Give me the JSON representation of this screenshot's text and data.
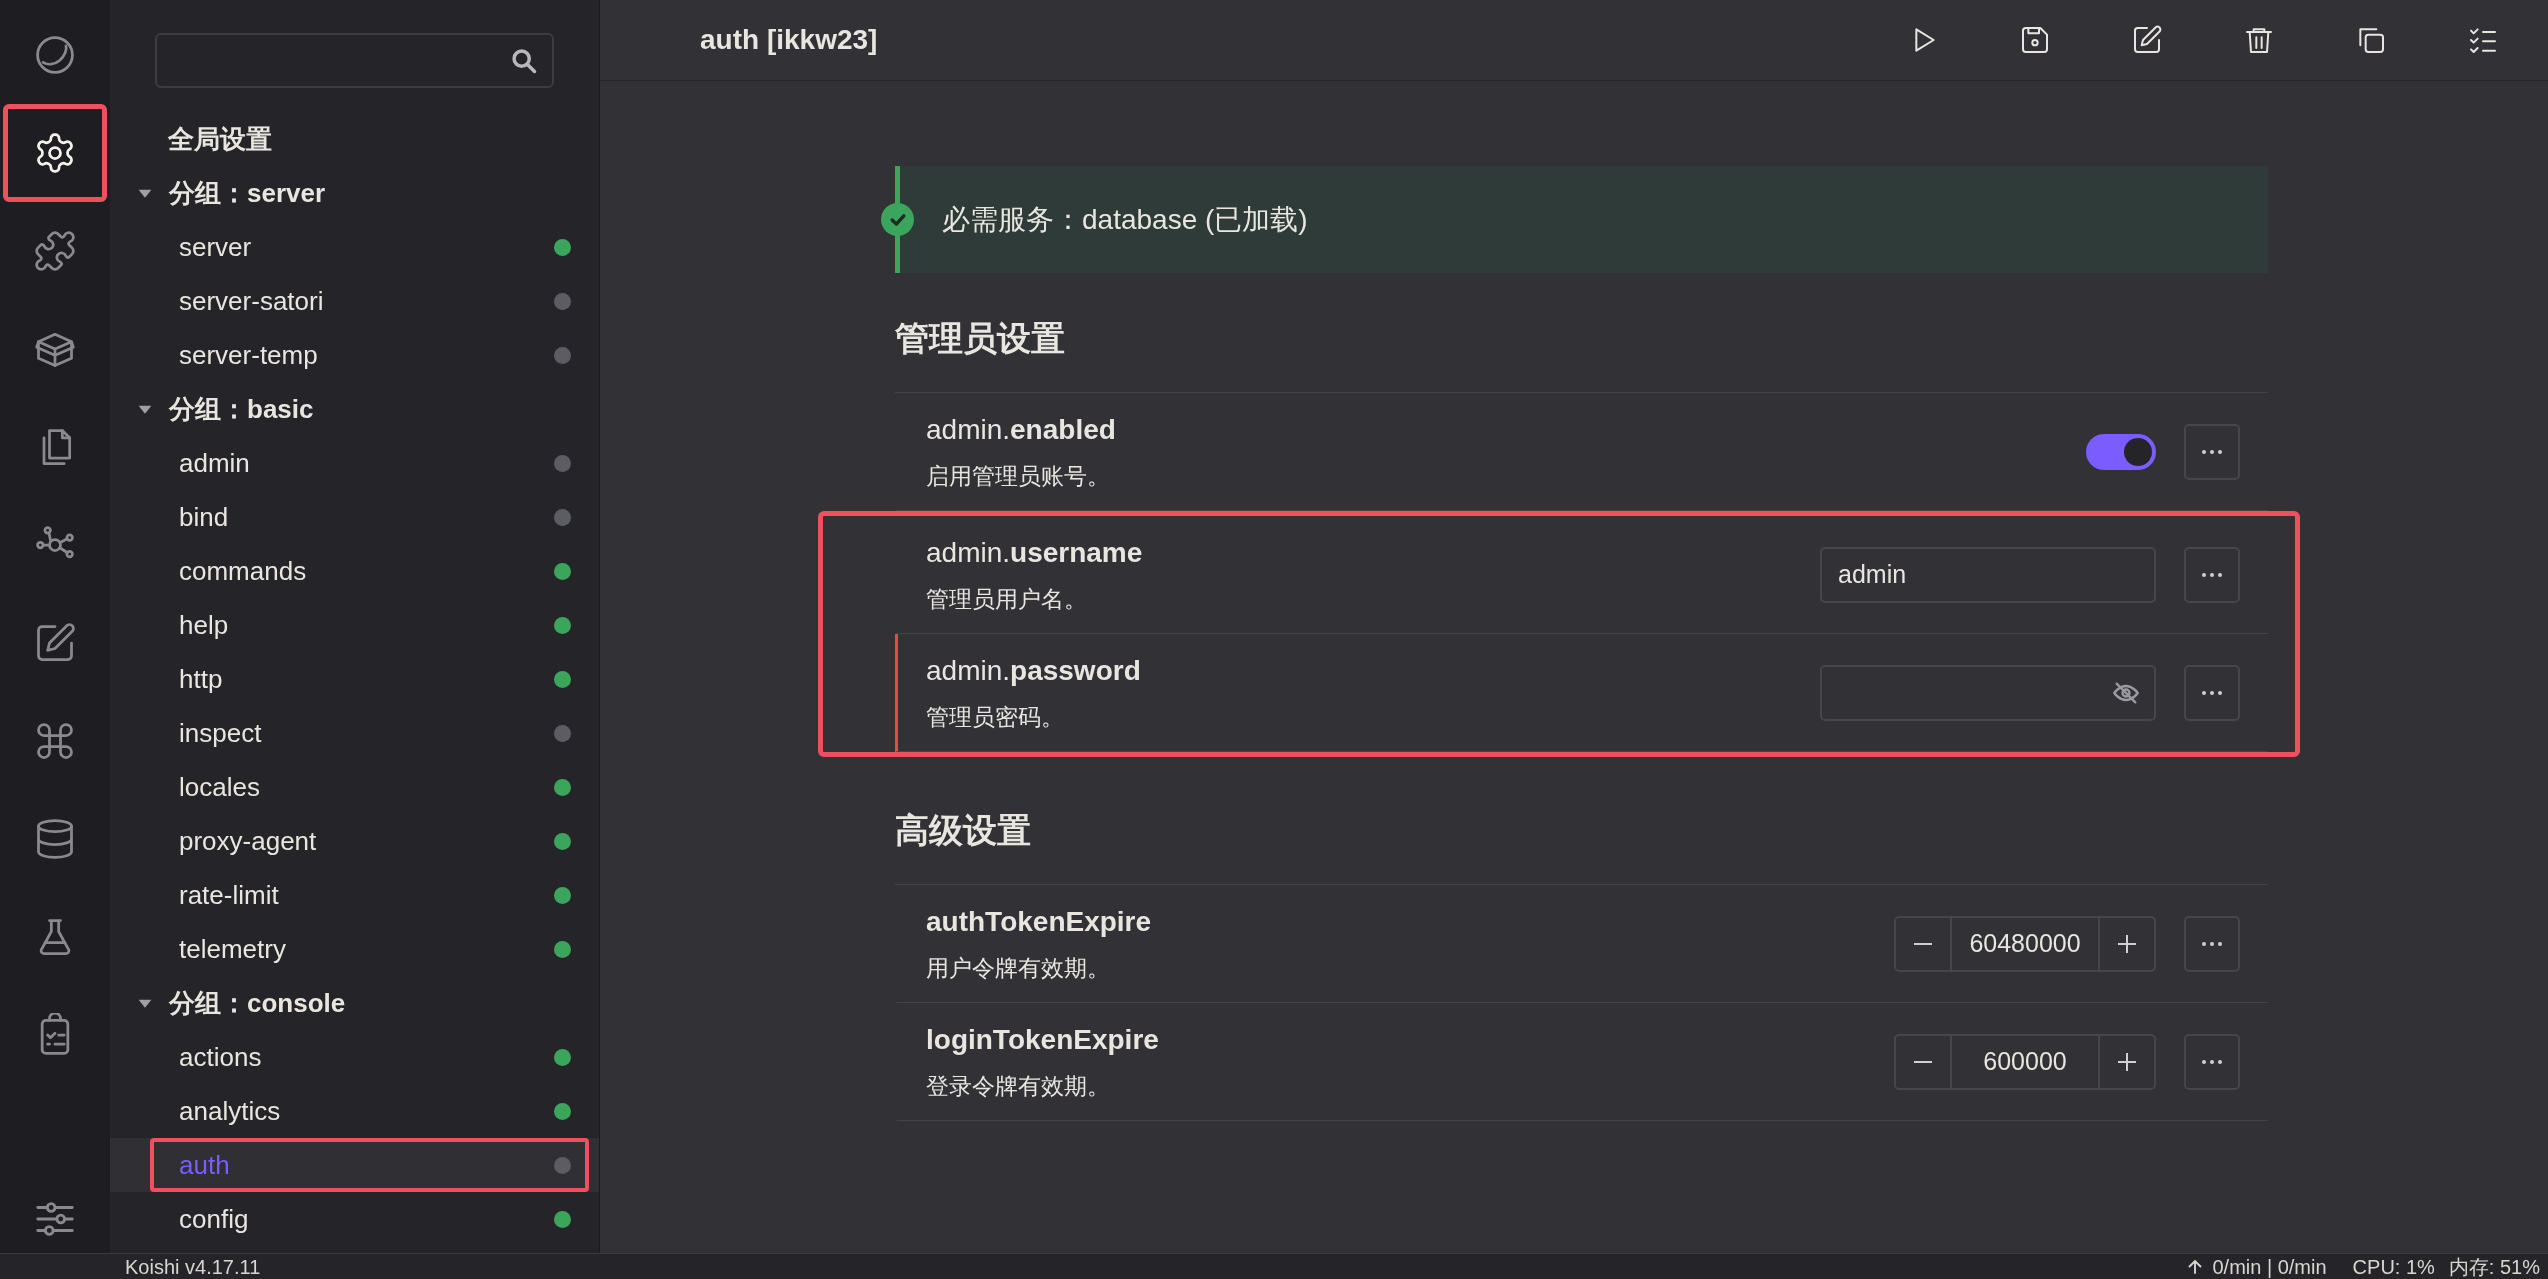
{
  "activity_bar": {
    "items": [
      {
        "kind": "dashboard",
        "selected": false,
        "highlighted": false
      },
      {
        "kind": "settings",
        "selected": true,
        "highlighted": true
      },
      {
        "kind": "puzzle",
        "selected": false,
        "highlighted": false
      },
      {
        "kind": "box",
        "selected": false,
        "highlighted": false
      },
      {
        "kind": "files",
        "selected": false,
        "highlighted": false
      },
      {
        "kind": "network",
        "selected": false,
        "highlighted": false
      },
      {
        "kind": "edit",
        "selected": false,
        "highlighted": false
      },
      {
        "kind": "command",
        "selected": false,
        "highlighted": false
      },
      {
        "kind": "database",
        "selected": false,
        "highlighted": false
      },
      {
        "kind": "flask",
        "selected": false,
        "highlighted": false
      },
      {
        "kind": "clipboard",
        "selected": false,
        "highlighted": false
      }
    ],
    "bottom": {
      "kind": "sliders"
    }
  },
  "sidebar": {
    "global_settings": "全局设置",
    "groups": [
      {
        "label": "分组：server",
        "expanded": true,
        "children": [
          {
            "label": "server",
            "color": "#3ba55c",
            "selected": false,
            "highlighted": false
          },
          {
            "label": "server-satori",
            "color": "#5c5c63",
            "selected": false,
            "highlighted": false
          },
          {
            "label": "server-temp",
            "color": "#5c5c63",
            "selected": false,
            "highlighted": false
          }
        ]
      },
      {
        "label": "分组：basic",
        "expanded": true,
        "children": [
          {
            "label": "admin",
            "color": "#5c5c63",
            "selected": false,
            "highlighted": false
          },
          {
            "label": "bind",
            "color": "#5c5c63",
            "selected": false,
            "highlighted": false
          },
          {
            "label": "commands",
            "color": "#3ba55c",
            "selected": false,
            "highlighted": false
          },
          {
            "label": "help",
            "color": "#3ba55c",
            "selected": false,
            "highlighted": false
          },
          {
            "label": "http",
            "color": "#3ba55c",
            "selected": false,
            "highlighted": false
          },
          {
            "label": "inspect",
            "color": "#5c5c63",
            "selected": false,
            "highlighted": false
          },
          {
            "label": "locales",
            "color": "#3ba55c",
            "selected": false,
            "highlighted": false
          },
          {
            "label": "proxy-agent",
            "color": "#3ba55c",
            "selected": false,
            "highlighted": false
          },
          {
            "label": "rate-limit",
            "color": "#3ba55c",
            "selected": false,
            "highlighted": false
          },
          {
            "label": "telemetry",
            "color": "#3ba55c",
            "selected": false,
            "highlighted": false
          }
        ]
      },
      {
        "label": "分组：console",
        "expanded": true,
        "children": [
          {
            "label": "actions",
            "color": "#3ba55c",
            "selected": false,
            "highlighted": false
          },
          {
            "label": "analytics",
            "color": "#3ba55c",
            "selected": false,
            "highlighted": false
          },
          {
            "label": "auth",
            "color": "#5c5c63",
            "selected": true,
            "highlighted": true
          },
          {
            "label": "config",
            "color": "#3ba55c",
            "selected": false,
            "highlighted": false
          }
        ]
      }
    ]
  },
  "header": {
    "title": "auth [ikkw23]",
    "tools": [
      {
        "kind": "play"
      },
      {
        "kind": "save"
      },
      {
        "kind": "edit"
      },
      {
        "kind": "trash"
      },
      {
        "kind": "copy"
      },
      {
        "kind": "checklist"
      }
    ]
  },
  "notice": {
    "text": "必需服务：database (已加载)"
  },
  "sections": [
    {
      "title": "管理员设置",
      "rows": [
        {
          "kind": "switch",
          "prefix": "admin.",
          "key": "enabled",
          "description": "启用管理员账号。",
          "on": true,
          "modified": false,
          "highlighted": false
        },
        {
          "kind": "text",
          "prefix": "admin.",
          "key": "username",
          "description": "管理员用户名。",
          "value": "admin",
          "modified": false,
          "highlighted": true
        },
        {
          "kind": "password",
          "prefix": "admin.",
          "key": "password",
          "description": "管理员密码。",
          "modified": true,
          "highlighted": true
        }
      ]
    },
    {
      "title": "高级设置",
      "rows": [
        {
          "kind": "number",
          "key": "authTokenExpire",
          "description": "用户令牌有效期。",
          "value": "60480000",
          "modified": false,
          "highlighted": false
        },
        {
          "kind": "number",
          "key": "loginTokenExpire",
          "description": "登录令牌有效期。",
          "value": "600000",
          "modified": false,
          "highlighted": false
        }
      ]
    }
  ],
  "status_bar": {
    "version": "Koishi v4.17.11",
    "traffic": "0/min | 0/min",
    "cpu": "CPU: 1%",
    "memory": "内存: 51%"
  }
}
